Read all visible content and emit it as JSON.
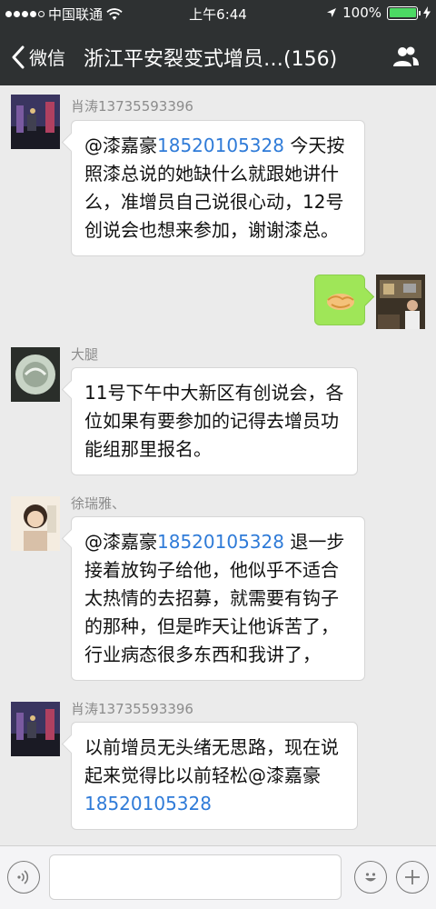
{
  "status_bar": {
    "carrier": "中国联通",
    "time": "上午6:44",
    "battery_percent": "100%",
    "battery_level": 1.0
  },
  "nav": {
    "back_label": "微信",
    "title": "浙江平安裂变式增员…(156)",
    "people_icon": "group-icon"
  },
  "messages": [
    {
      "sender": "肖涛13735593396",
      "mention": "@漆嘉豪",
      "phone": "18520105328",
      "text": " 今天按照漆总说的她缺什么就跟她讲什么，准增员自己说很心动，12号创说会也想来参加，谢谢漆总。"
    },
    {
      "sender": "",
      "self": true,
      "content_icon": "handshake-sticker-icon"
    },
    {
      "sender": "大腿",
      "text": "11号下午中大新区有创说会，各位如果有要参加的记得去增员功能组那里报名。"
    },
    {
      "sender": "徐瑞雅、",
      "mention": "@漆嘉豪",
      "phone": "18520105328",
      "text": " 退一步接着放钩子给他，他似乎不适合太热情的去招募，就需要有钩子的那种，但是昨天让他诉苦了，行业病态很多东西和我讲了，"
    },
    {
      "sender": "肖涛13735593396",
      "text": "以前增员无头绪无思路，现在说起来觉得比以前轻松@漆嘉豪",
      "phone": "18520105328"
    }
  ],
  "input_bar": {
    "voice_icon": "voice-icon",
    "emoji_icon": "emoji-icon",
    "plus_icon": "plus-icon",
    "placeholder": ""
  },
  "colors": {
    "header_bg": "#2e3132",
    "self_bubble": "#9fe658",
    "link": "#2f7bd8",
    "chat_bg": "#ebebeb"
  }
}
